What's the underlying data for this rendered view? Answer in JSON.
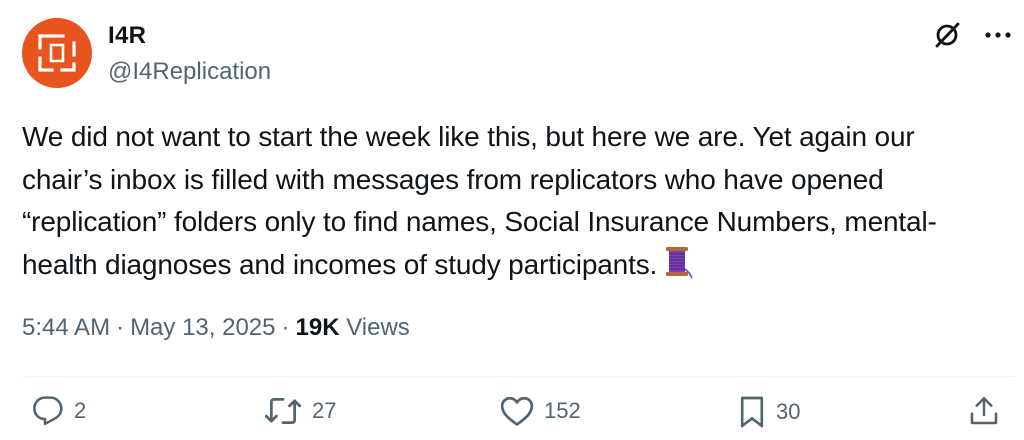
{
  "author": {
    "name": "I4R",
    "handle": "@I4Replication"
  },
  "header_icons": [
    "grok-icon",
    "more-icon"
  ],
  "tweet": {
    "lines": [
      "We did not want to start the week like this, but here we are. Yet again our",
      "chair’s inbox is filled with messages from replicators who have opened",
      "“replication” folders only to find names, Social Insurance Numbers, mental-",
      "health diagnoses and incomes of study participants."
    ],
    "emoji": "thread-spool-emoji"
  },
  "meta": {
    "time": "5:44 AM",
    "separator": "·",
    "date": "May 13, 2025",
    "views_count": "19K",
    "views_label": "Views"
  },
  "actions": {
    "replies": "2",
    "reposts": "27",
    "likes": "152",
    "bookmarks": "30"
  },
  "colors": {
    "avatar_bg": "#e8541e",
    "text": "#0f1419",
    "secondary": "#536471"
  }
}
